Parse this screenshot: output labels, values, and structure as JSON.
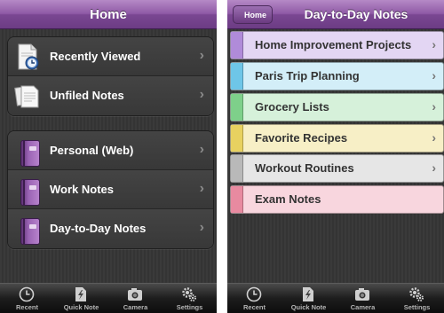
{
  "left_screen": {
    "title": "Home",
    "group1": [
      {
        "label": "Recently Viewed",
        "icon": "recent-document-icon"
      },
      {
        "label": "Unfiled Notes",
        "icon": "unfiled-notes-icon"
      }
    ],
    "group2": [
      {
        "label": "Personal (Web)",
        "icon": "notebook-icon"
      },
      {
        "label": "Work Notes",
        "icon": "notebook-icon"
      },
      {
        "label": "Day-to-Day Notes",
        "icon": "notebook-icon"
      }
    ]
  },
  "right_screen": {
    "back_label": "Home",
    "title": "Day-to-Day Notes",
    "sections": [
      {
        "label": "Home Improvement Projects",
        "color": "#b08bd9",
        "bg": "#e3d6f3"
      },
      {
        "label": "Paris Trip Planning",
        "color": "#6ec6e8",
        "bg": "#d3eef8"
      },
      {
        "label": "Grocery Lists",
        "color": "#7ed08a",
        "bg": "#d6f1da"
      },
      {
        "label": "Favorite Recipes",
        "color": "#e8d160",
        "bg": "#f7efc6"
      },
      {
        "label": "Workout Routines",
        "color": "#b9b9b9",
        "bg": "#e6e6e6"
      },
      {
        "label": "Exam Notes",
        "color": "#e88aa0",
        "bg": "#f8d6de"
      }
    ]
  },
  "tabbar": [
    {
      "label": "Recent",
      "icon": "clock-icon"
    },
    {
      "label": "Quick Note",
      "icon": "quick-note-icon"
    },
    {
      "label": "Camera",
      "icon": "camera-icon"
    },
    {
      "label": "Settings",
      "icon": "settings-gears-icon"
    }
  ]
}
